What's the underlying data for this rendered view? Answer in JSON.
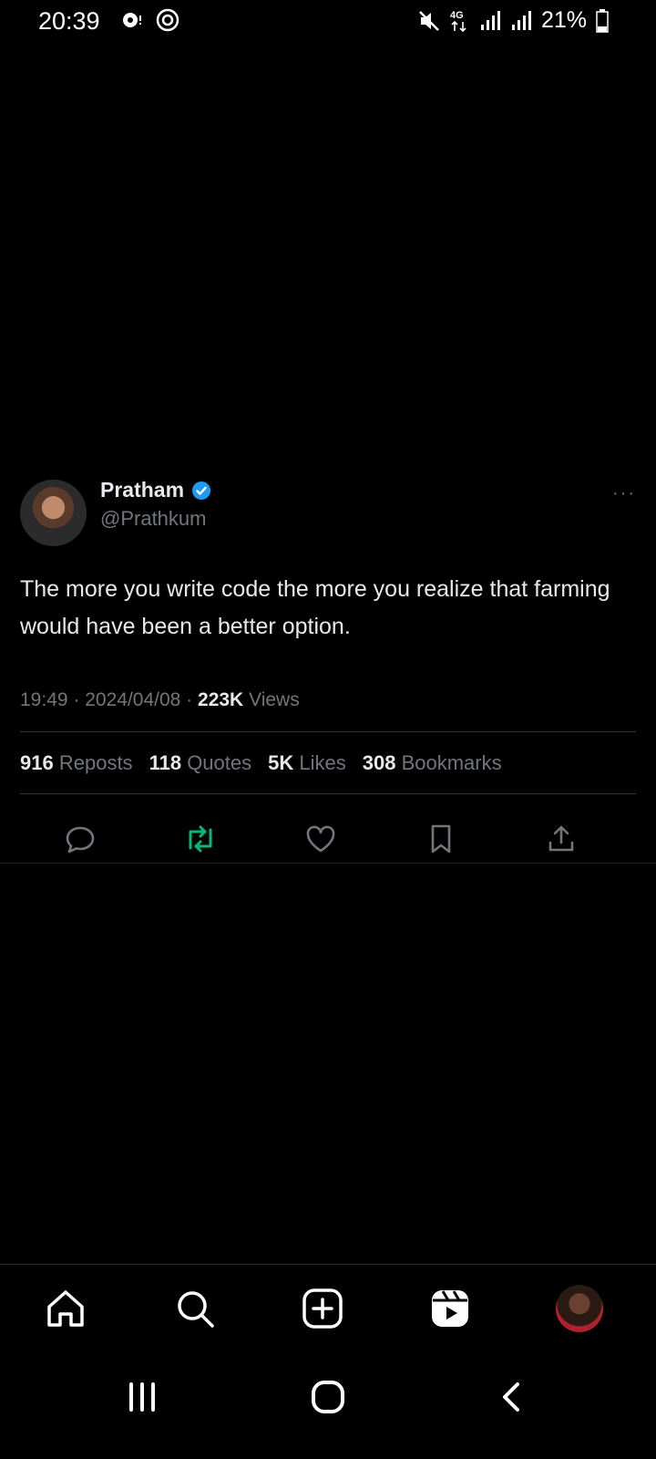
{
  "status_bar": {
    "time": "20:39",
    "network": "4G",
    "battery": "21%"
  },
  "tweet": {
    "author_name": "Pratham",
    "handle": "@Prathkum",
    "text": "The more you write code the more you realize that farming would have been a better option.",
    "time": "19:49",
    "date": "2024/04/08",
    "views_count": "223K",
    "views_label": "Views",
    "stats": [
      {
        "count": "916",
        "label": "Reposts"
      },
      {
        "count": "118",
        "label": "Quotes"
      },
      {
        "count": "5K",
        "label": "Likes"
      },
      {
        "count": "308",
        "label": "Bookmarks"
      }
    ],
    "more_label": "···"
  },
  "colors": {
    "verified": "#1d9bf0",
    "repost_active": "#00ba7c",
    "muted": "#71767b"
  },
  "app_nav": [
    "home-icon",
    "search-icon",
    "create-icon",
    "reels-icon",
    "profile-avatar"
  ],
  "system_nav": [
    "recents-icon",
    "home-circle-icon",
    "back-icon"
  ]
}
